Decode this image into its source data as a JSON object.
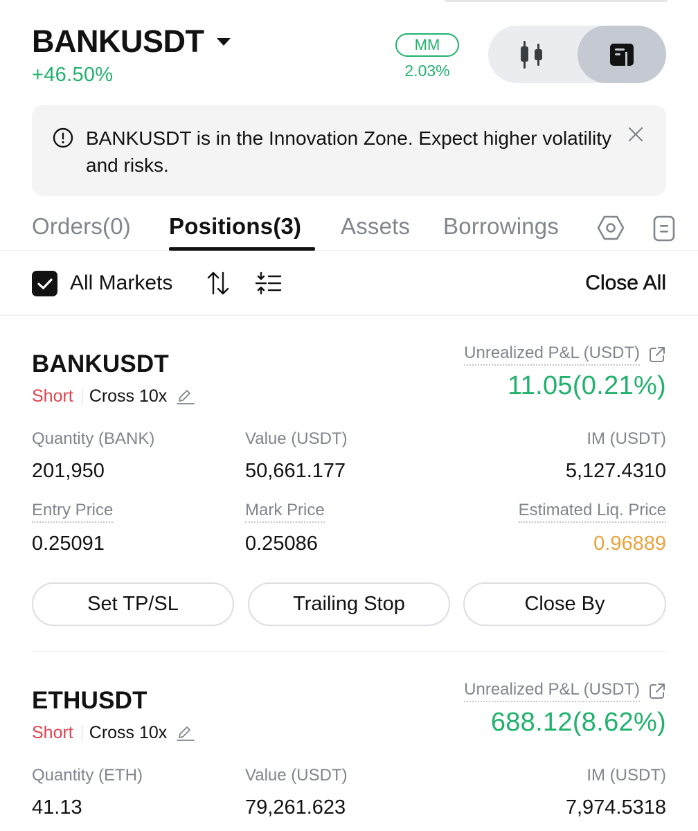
{
  "header": {
    "symbol": "BANKUSDT",
    "change": "+46.50%",
    "mm_label": "MM",
    "mm_value": "2.03%"
  },
  "notice": {
    "text": "BANKUSDT is in the Innovation Zone. Expect higher volatility and risks."
  },
  "tabs": [
    {
      "label": "Orders(0)"
    },
    {
      "label": "Positions(3)"
    },
    {
      "label": "Assets"
    },
    {
      "label": "Borrowings"
    }
  ],
  "filter": {
    "all_markets": "All Markets",
    "close_all": "Close All"
  },
  "positions": [
    {
      "symbol": "BANKUSDT",
      "side": "Short",
      "margin": "Cross 10x",
      "pnl_label": "Unrealized P&L (USDT)",
      "pnl": "11.05(0.21%)",
      "qty_label": "Quantity (BANK)",
      "qty": "201,950",
      "value_label": "Value (USDT)",
      "value": "50,661.177",
      "im_label": "IM (USDT)",
      "im": "5,127.4310",
      "entry_label": "Entry Price",
      "entry": "0.25091",
      "mark_label": "Mark Price",
      "mark": "0.25086",
      "liq_label": "Estimated Liq. Price",
      "liq": "0.96889",
      "buttons": [
        "Set TP/SL",
        "Trailing Stop",
        "Close By"
      ]
    },
    {
      "symbol": "ETHUSDT",
      "side": "Short",
      "margin": "Cross 10x",
      "pnl_label": "Unrealized P&L (USDT)",
      "pnl": "688.12(8.62%)",
      "qty_label": "Quantity (ETH)",
      "qty": "41.13",
      "value_label": "Value (USDT)",
      "value": "79,261.623",
      "im_label": "IM (USDT)",
      "im": "7,974.5318"
    }
  ],
  "colors": {
    "green": "#20b26c",
    "red": "#e0424d",
    "orange": "#e9a23b",
    "text": "#121212",
    "muted": "#81858c"
  }
}
